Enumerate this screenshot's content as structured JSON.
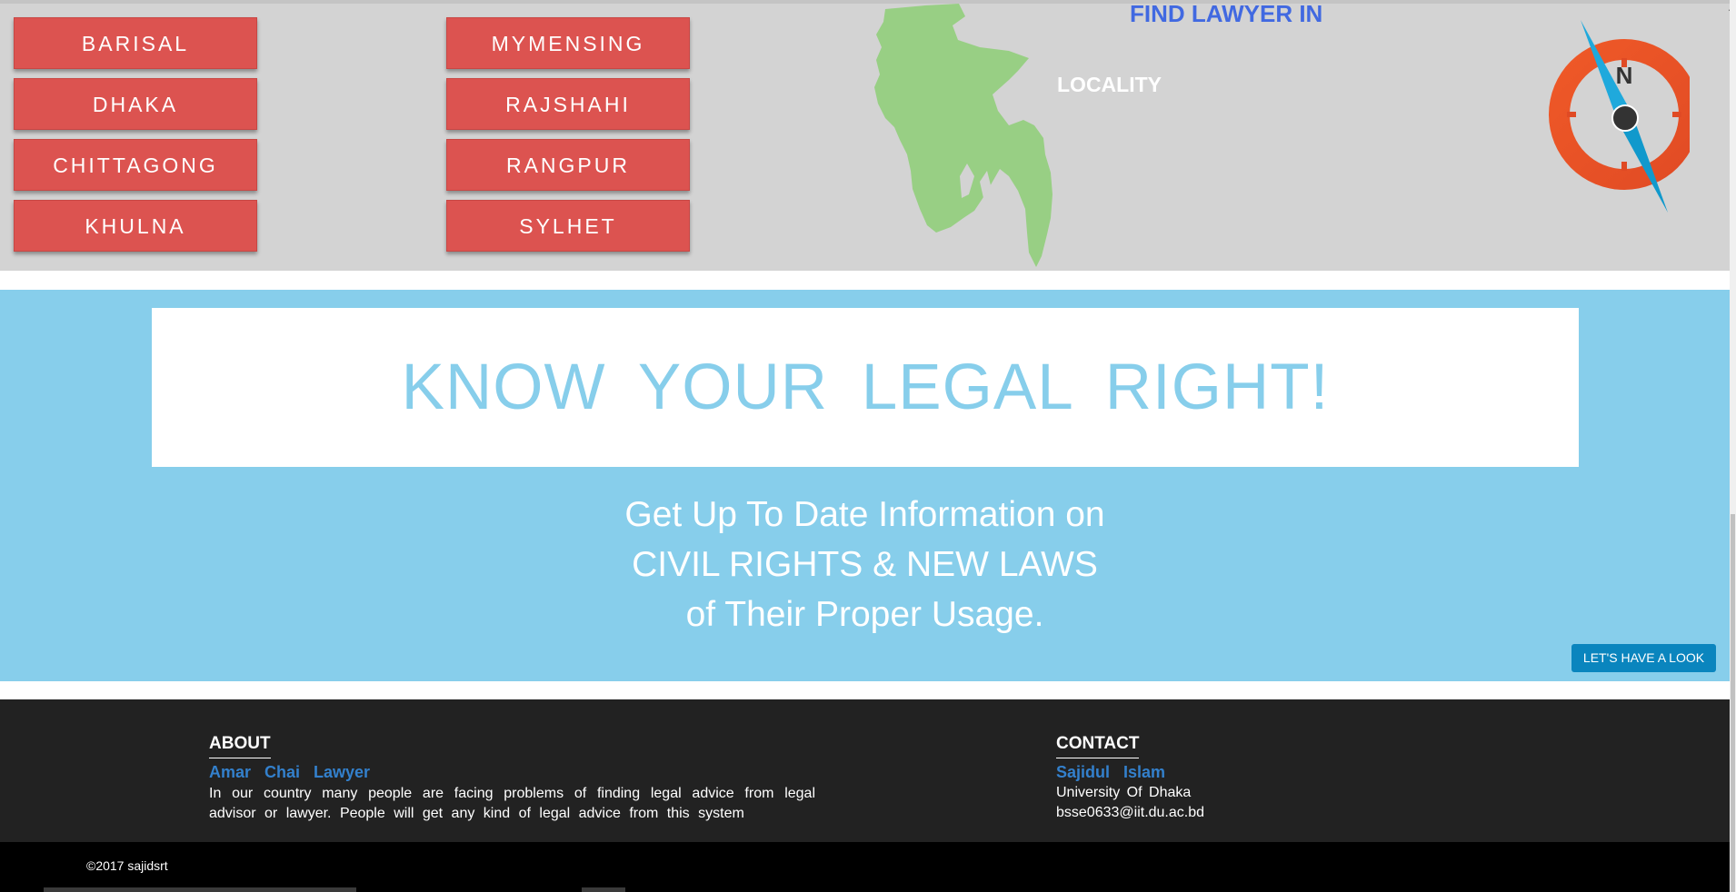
{
  "locations": {
    "title": "FIND LAWYER IN",
    "subtitle": "LOCALITY",
    "compass_letter": "N",
    "cities": [
      {
        "label": "BARISAL"
      },
      {
        "label": "DHAKA"
      },
      {
        "label": "CHITTAGONG"
      },
      {
        "label": "KHULNA"
      },
      {
        "label": "MYMENSING"
      },
      {
        "label": "RAJSHAHI"
      },
      {
        "label": "RANGPUR"
      },
      {
        "label": "SYLHET"
      }
    ]
  },
  "legal": {
    "heading": "KNOW YOUR LEGAL RIGHT!",
    "lines": [
      "Get Up To Date Information on",
      "CIVIL RIGHTS & NEW LAWS",
      "of Their Proper Usage."
    ],
    "cta_label": "LET'S HAVE A LOOK"
  },
  "footer": {
    "about": {
      "heading": "ABOUT",
      "name": "Amar Chai Lawyer",
      "text": "In our country many people are facing problems of finding legal advice from legal advisor or lawyer. People will get any kind of legal advice from this system"
    },
    "contact": {
      "heading": "CONTACT",
      "name": "Sajidul Islam",
      "institution": "University Of Dhaka",
      "email": "bsse0633@iit.du.ac.bd"
    },
    "copyright": "©2017 sajidsrt"
  },
  "colors": {
    "city_button": "#dc5350",
    "section_gray": "#d3d3d3",
    "sky": "#87ceeb",
    "title_blue": "#4169e1",
    "link_blue": "#3380cc",
    "footer_dark": "#222222",
    "cta_blue": "#0a85be"
  },
  "icons": [
    "bangladesh-map-icon",
    "compass-icon"
  ]
}
